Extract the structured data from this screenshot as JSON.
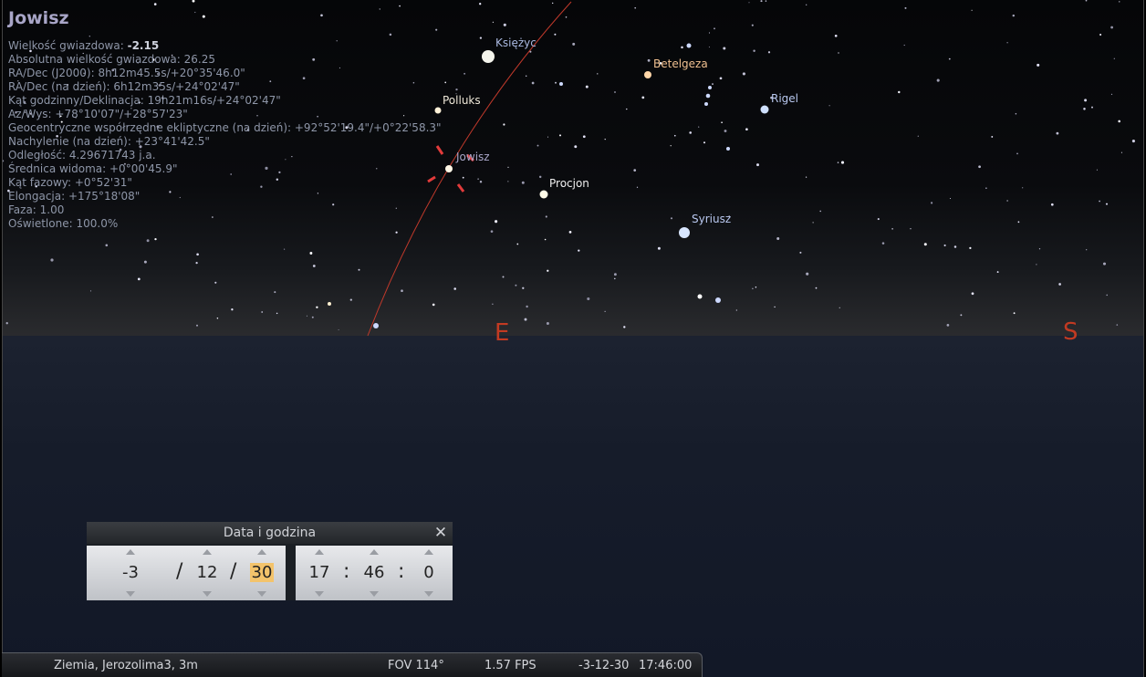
{
  "object_info": {
    "name": "Jowisz",
    "rows": [
      {
        "label": "Wielkość gwiazdowa: ",
        "value": "-2.15",
        "bold": true
      },
      {
        "label": "Absolutna wielkość gwiazdowa: ",
        "value": "26.25"
      },
      {
        "label": "RA/Dec (J2000): ",
        "value": "8h12m45.5s/+20°35'46.0\""
      },
      {
        "label": "RA/Dec (na dzień): ",
        "value": "6h12m35s/+24°02'47\""
      },
      {
        "label": "Kąt godzinny/Deklinacja: ",
        "value": "19h21m16s/+24°02'47\""
      },
      {
        "label": "Az/Wys: ",
        "value": "+78°10'07\"/+28°57'23\""
      },
      {
        "label": "Geocentryczne współrzędne ekliptyczne (na dzień): ",
        "value": "+92°52'19.4\"/+0°22'58.3\""
      },
      {
        "label": "Nachylenie (na dzień): ",
        "value": "+23°41'42.5\""
      },
      {
        "label": "Odległość: ",
        "value": "4.29671743 j.a."
      },
      {
        "label": "Średnica widoma: ",
        "value": "+0°00'45.9\""
      },
      {
        "label": "Kąt fazowy: ",
        "value": "+0°52'31\""
      },
      {
        "label": "Elongacja: ",
        "value": "+175°18'08\""
      },
      {
        "label": "Faza: ",
        "value": "1.00"
      },
      {
        "label": "Oświetlone: ",
        "value": "100.0%"
      }
    ]
  },
  "sky": {
    "labels": {
      "moon": "Księżyc",
      "betelgeuse": "Betelgeza",
      "rigel": "Rigel",
      "pollux": "Polluks",
      "jupiter": "Jowisz",
      "procyon": "Procjon",
      "sirius": "Syriusz"
    },
    "compass": {
      "east": "E",
      "south": "S"
    },
    "colors": {
      "ecliptic": "#c0392b",
      "selection": "#e23b3b",
      "compass": "#c23a22"
    }
  },
  "date_time_window": {
    "title": "Data i godzina",
    "close_icon": "close-icon",
    "year": "-3",
    "month": "12",
    "day": "30",
    "hour": "17",
    "minute": "46",
    "second": "0",
    "date_sep": "/",
    "time_sep": ":"
  },
  "status_bar": {
    "location": "Ziemia, Jerozolima3, 3m",
    "fov": "FOV 114°",
    "fps": "1.57 FPS",
    "date": "-3-12-30",
    "time": "17:46:00"
  }
}
